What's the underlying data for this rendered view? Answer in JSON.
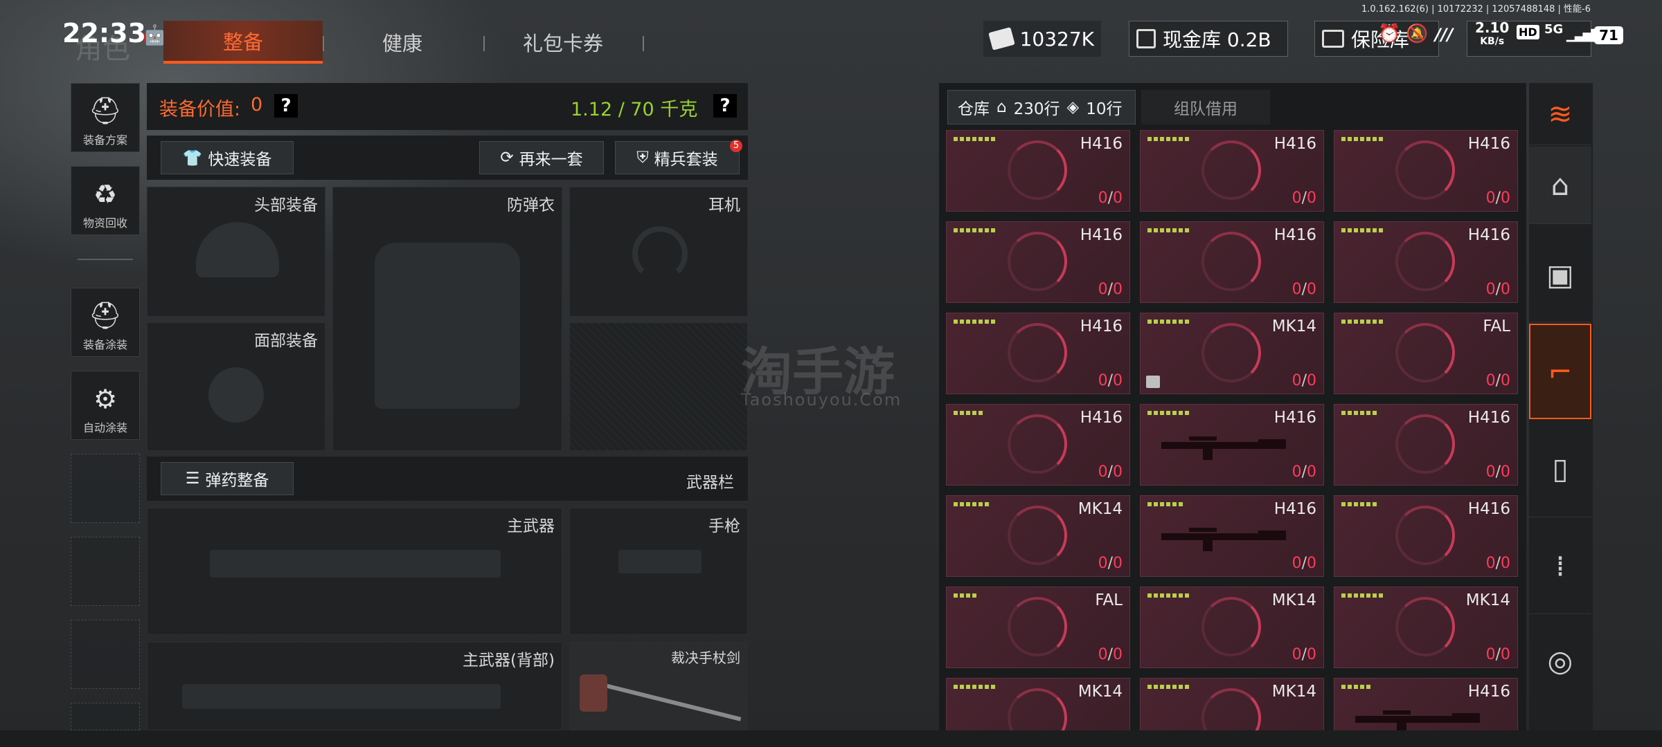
{
  "status_bar": {
    "time": "22:33",
    "ghost_text": "角色",
    "version": "1.0.162.162(6) | 10172232 | 12057488148 | 性能-6",
    "net_speed": "2.10",
    "net_unit": "KB/s",
    "hd": "HD",
    "signal": "5G",
    "battery": "71"
  },
  "tabs": [
    {
      "label": "整备",
      "active": true
    },
    {
      "label": "健康",
      "active": false
    },
    {
      "label": "礼包卡券",
      "active": false
    }
  ],
  "currency": {
    "money": "10327K",
    "cash_vault": "现金库 0.2B",
    "safe": "保险库"
  },
  "sidebar": [
    {
      "label": "装备方案",
      "icon": "helmet-grid-icon"
    },
    {
      "label": "物资回收",
      "icon": "recycle-face-icon"
    },
    {
      "label": "装备涂装",
      "icon": "paint-helmet-icon"
    },
    {
      "label": "自动涂装",
      "icon": "brush-gear-icon"
    }
  ],
  "equipment": {
    "value_label": "装备价值:",
    "value": "0",
    "help": "?",
    "weight": "1.12 / 70 千克",
    "quick_equip": "快速装备",
    "again": "再来一套",
    "elite": "精兵套装",
    "elite_badge": "5",
    "slots": {
      "head": "头部装备",
      "armor": "防弹衣",
      "headset": "耳机",
      "face": "面部装备",
      "main_weapon": "主武器",
      "pistol": "手枪",
      "back_weapon": "主武器(背部)",
      "melee": "裁决手杖剑"
    },
    "ammo": "弹药整备",
    "weapon_bar": "武器栏"
  },
  "warehouse": {
    "tab_label": "仓库",
    "rows": "230行",
    "ticket_rows": "10行",
    "team_borrow": "组队借用",
    "items": [
      {
        "name": "H416",
        "cnt": "0",
        "max": "0",
        "bars": 7,
        "gun": false
      },
      {
        "name": "H416",
        "cnt": "0",
        "max": "0",
        "bars": 7,
        "gun": false
      },
      {
        "name": "H416",
        "cnt": "0",
        "max": "0",
        "bars": 7,
        "gun": false
      },
      {
        "name": "H416",
        "cnt": "0",
        "max": "0",
        "bars": 7,
        "gun": false
      },
      {
        "name": "H416",
        "cnt": "0",
        "max": "0",
        "bars": 7,
        "gun": false
      },
      {
        "name": "H416",
        "cnt": "0",
        "max": "0",
        "bars": 7,
        "gun": false
      },
      {
        "name": "H416",
        "cnt": "0",
        "max": "0",
        "bars": 7,
        "gun": false
      },
      {
        "name": "MK14",
        "cnt": "0",
        "max": "0",
        "bars": 7,
        "gun": false
      },
      {
        "name": "FAL",
        "cnt": "0",
        "max": "0",
        "bars": 7,
        "gun": false
      },
      {
        "name": "H416",
        "cnt": "0",
        "max": "0",
        "bars": 5,
        "gun": false
      },
      {
        "name": "H416",
        "cnt": "0",
        "max": "0",
        "bars": 7,
        "gun": true
      },
      {
        "name": "H416",
        "cnt": "0",
        "max": "0",
        "bars": 6,
        "gun": false
      },
      {
        "name": "MK14",
        "cnt": "0",
        "max": "0",
        "bars": 6,
        "gun": false
      },
      {
        "name": "H416",
        "cnt": "0",
        "max": "0",
        "bars": 6,
        "gun": true
      },
      {
        "name": "H416",
        "cnt": "0",
        "max": "0",
        "bars": 6,
        "gun": false
      },
      {
        "name": "FAL",
        "cnt": "0",
        "max": "0",
        "bars": 4,
        "gun": false
      },
      {
        "name": "MK14",
        "cnt": "0",
        "max": "0",
        "bars": 7,
        "gun": false
      },
      {
        "name": "MK14",
        "cnt": "0",
        "max": "0",
        "bars": 7,
        "gun": false
      },
      {
        "name": "MK14",
        "cnt": "0",
        "max": "0",
        "bars": 7,
        "gun": false
      },
      {
        "name": "MK14",
        "cnt": "0",
        "max": "0",
        "bars": 7,
        "gun": false
      },
      {
        "name": "H416",
        "cnt": "",
        "max": "",
        "bars": 5,
        "gun": true
      }
    ]
  },
  "right_tabs": [
    "stack-refresh-icon",
    "home-icon",
    "vest-icon",
    "rifle-icon",
    "magazine-icon",
    "bullet-icon",
    "scope-icon"
  ],
  "watermark": {
    "cn": "淘手游",
    "en": "Taoshouyou.Com"
  }
}
